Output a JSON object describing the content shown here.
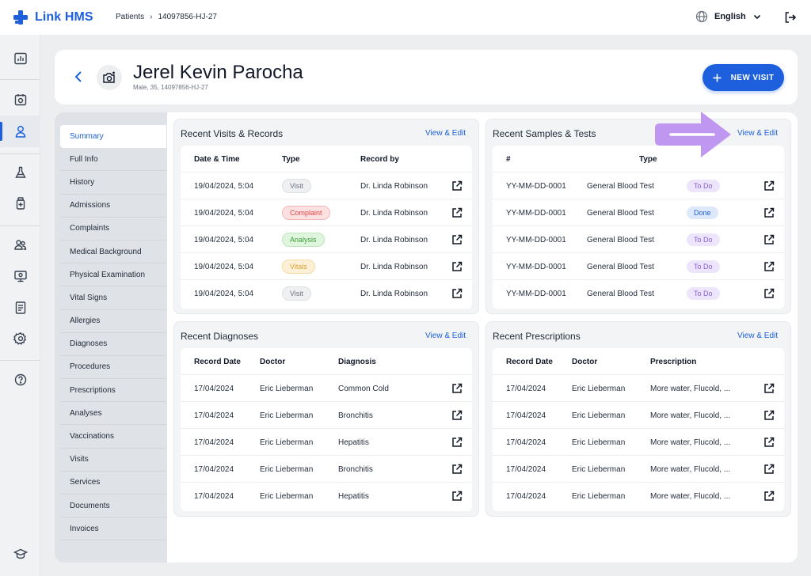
{
  "app": {
    "name": "Link HMS",
    "brand_color": "#1d5fdc"
  },
  "breadcrumb": {
    "items": [
      "Patients",
      "14097856-HJ-27"
    ],
    "separator": "›"
  },
  "header": {
    "language": "English"
  },
  "patient": {
    "name": "Jerel Kevin Parocha",
    "meta": "Male, 35, 14097856-HJ-27",
    "new_visit_label": "NEW VISIT"
  },
  "rail_icons": [
    "reports-icon",
    "calendar-icon",
    "patient-icon",
    "lab-flask-icon",
    "medicine-bottle-icon",
    "staff-icon",
    "monitor-icon",
    "document-icon",
    "settings-icon",
    "help-icon",
    "education-icon"
  ],
  "sections": {
    "active": "Summary",
    "items": [
      "Summary",
      "Full Info",
      "History",
      "Admissions",
      "Complaints",
      "Medical Background",
      "Physical Examination",
      "Vital Signs",
      "Allergies",
      "Diagnoses",
      "Procedures",
      "Prescriptions",
      "Analyses",
      "Vaccinations",
      "Visits",
      "Services",
      "Documents",
      "Invoices"
    ]
  },
  "cards": {
    "visits": {
      "title": "Recent Visits & Records",
      "link": "View & Edit",
      "columns": [
        "Date & Time",
        "Type",
        "Record by"
      ],
      "rows": [
        {
          "date": "19/04/2024, 5:04",
          "type": "Visit",
          "by": "Dr. Linda Robinson"
        },
        {
          "date": "19/04/2024, 5:04",
          "type": "Complaint",
          "by": "Dr. Linda Robinson"
        },
        {
          "date": "19/04/2024, 5:04",
          "type": "Analysis",
          "by": "Dr. Linda Robinson"
        },
        {
          "date": "19/04/2024, 5:04",
          "type": "Vitals",
          "by": "Dr. Linda Robinson"
        },
        {
          "date": "19/04/2024, 5:04",
          "type": "Visit",
          "by": "Dr. Linda Robinson"
        }
      ]
    },
    "samples": {
      "title": "Recent Samples & Tests",
      "link": "View & Edit",
      "columns": [
        "#",
        "Type"
      ],
      "rows": [
        {
          "id": "YY-MM-DD-0001",
          "type": "General Blood Test",
          "status": "To Do"
        },
        {
          "id": "YY-MM-DD-0001",
          "type": "General Blood Test",
          "status": "Done"
        },
        {
          "id": "YY-MM-DD-0001",
          "type": "General Blood Test",
          "status": "To Do"
        },
        {
          "id": "YY-MM-DD-0001",
          "type": "General Blood Test",
          "status": "To Do"
        },
        {
          "id": "YY-MM-DD-0001",
          "type": "General Blood Test",
          "status": "To Do"
        }
      ]
    },
    "diagnoses": {
      "title": "Recent Diagnoses",
      "link": "View & Edit",
      "columns": [
        "Record Date",
        "Doctor",
        "Diagnosis"
      ],
      "rows": [
        {
          "date": "17/04/2024",
          "doctor": "Eric Lieberman",
          "diagnosis": "Common Cold"
        },
        {
          "date": "17/04/2024",
          "doctor": "Eric Lieberman",
          "diagnosis": "Bronchitis"
        },
        {
          "date": "17/04/2024",
          "doctor": "Eric Lieberman",
          "diagnosis": "Hepatitis"
        },
        {
          "date": "17/04/2024",
          "doctor": "Eric Lieberman",
          "diagnosis": "Bronchitis"
        },
        {
          "date": "17/04/2024",
          "doctor": "Eric Lieberman",
          "diagnosis": "Hepatitis"
        }
      ]
    },
    "prescriptions": {
      "title": "Recent Prescriptions",
      "link": "View & Edit",
      "columns": [
        "Record Date",
        "Doctor",
        "Prescription"
      ],
      "rows": [
        {
          "date": "17/04/2024",
          "doctor": "Eric Lieberman",
          "prescription": "More water, Flucold, ..."
        },
        {
          "date": "17/04/2024",
          "doctor": "Eric Lieberman",
          "prescription": "More water, Flucold, ..."
        },
        {
          "date": "17/04/2024",
          "doctor": "Eric Lieberman",
          "prescription": "More water, Flucold, ..."
        },
        {
          "date": "17/04/2024",
          "doctor": "Eric Lieberman",
          "prescription": "More water, Flucold, ..."
        },
        {
          "date": "17/04/2024",
          "doctor": "Eric Lieberman",
          "prescription": "More water, Flucold, ..."
        }
      ]
    }
  },
  "colors": {
    "accent": "#1d5fdc",
    "todo_badge": "#8a5ad6",
    "done_badge": "#1d5fdc",
    "complaint_badge": "#e0474c",
    "analysis_badge": "#3c9c3a",
    "vitals_badge": "#d7a338",
    "pointer_arrow": "#b98cf0"
  }
}
